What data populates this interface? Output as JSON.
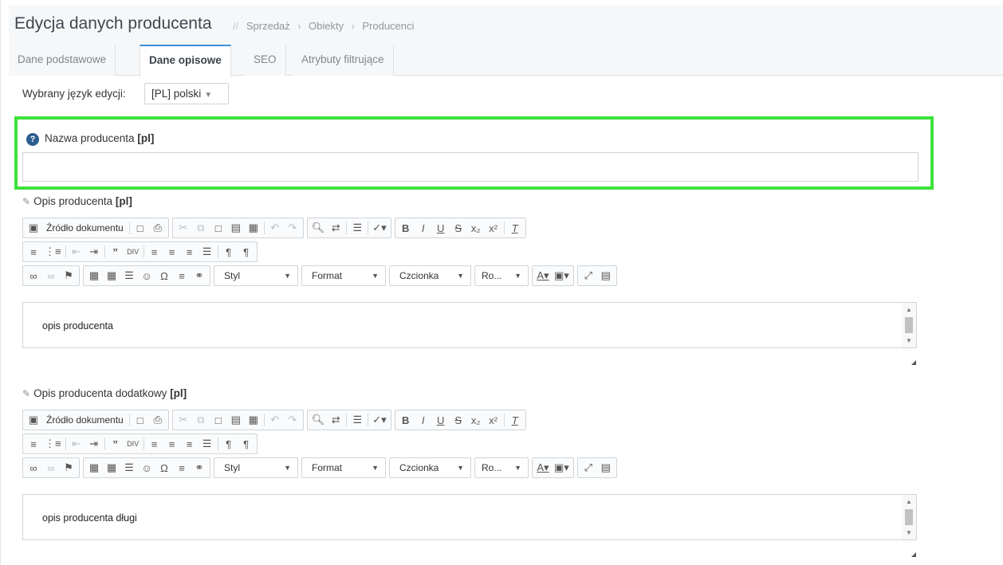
{
  "header": {
    "title": "Edycja danych producenta",
    "breadcrumb_separator": "//",
    "breadcrumb": [
      "Sprzedaż",
      "Obiekty",
      "Producenci"
    ]
  },
  "tabs": [
    {
      "label": "Dane podstawowe",
      "active": false
    },
    {
      "label": "Dane opisowe",
      "active": true
    },
    {
      "label": "SEO",
      "active": false
    },
    {
      "label": "Atrybuty filtrujące",
      "active": false
    }
  ],
  "language": {
    "label": "Wybrany język edycji:",
    "selected": "[PL] polski"
  },
  "name_field": {
    "help_icon_glyph": "?",
    "label": "Nazwa producenta",
    "lang_tag": "[pl]",
    "value": "",
    "highlight_color": "#3ee23a"
  },
  "toolbar": {
    "source_label": "Źródło dokumentu",
    "style_label": "Styl",
    "format_label": "Format",
    "font_label": "Czcionka",
    "size_label": "Ro..."
  },
  "editors": [
    {
      "label": "Opis producenta",
      "lang_tag": "[pl]",
      "content": "opis producenta"
    },
    {
      "label": "Opis producenta dodatkowy",
      "lang_tag": "[pl]",
      "content": "opis producenta długi"
    }
  ],
  "colors": {
    "active_tab_accent": "#3d8fd8",
    "header_bg": "#f5f7f9",
    "help_icon": "#2c5d8f"
  }
}
